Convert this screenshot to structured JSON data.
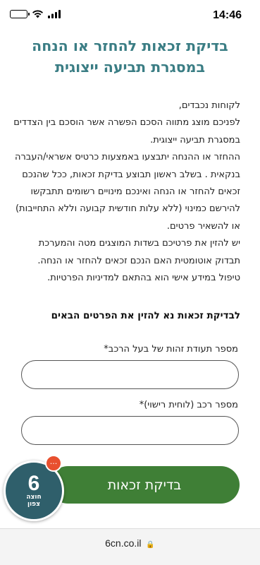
{
  "status": {
    "time": "14:46"
  },
  "page": {
    "title_line1": "בדיקת זכאות להחזר או הנחה",
    "title_line2": "במסגרת תביעה ייצוגית",
    "intro": [
      "לקוחות נכבדים,",
      "לפניכם מוצג מתווה הסכם הפשרה אשר הוסכם בין הצדדים במסגרת תביעה ייצוגית.",
      "ההחזר או ההנחה יתבצעו באמצעות כרטיס אשראי/העברה בנקאית . בשלב ראשון תבוצע בדיקת זכאות, ככל שהנכם זכאים להחזר או הנחה ואינכם מינויים רשומים תתבקשו להירשם כמינוי (ללא עלות חודשית קבועה וללא התחייבות) או להשאיר פרטים.",
      "יש להזין את פרטיכם בשדות המוצגים מטה והמערכת תבדוק אוטומטית האם הנכם זכאים להחזר או הנחה.",
      "טיפול במידע אישי הוא בהתאם למדיניות הפרטיות."
    ]
  },
  "form": {
    "heading": "לבדיקת זכאות נא להזין את הפרטים הבאים",
    "id_label": "מספר תעודת זהות של בעל הרכב*",
    "id_value": "",
    "car_label": "מספר רכב (לוחית רישוי)*",
    "car_value": "",
    "submit_label": "בדיקת זכאות"
  },
  "logo": {
    "number": "6",
    "line1": "חוצה",
    "line2": "צפון"
  },
  "chat_badge": {
    "icon": "···"
  },
  "browser": {
    "url": "6cn.co.il"
  }
}
